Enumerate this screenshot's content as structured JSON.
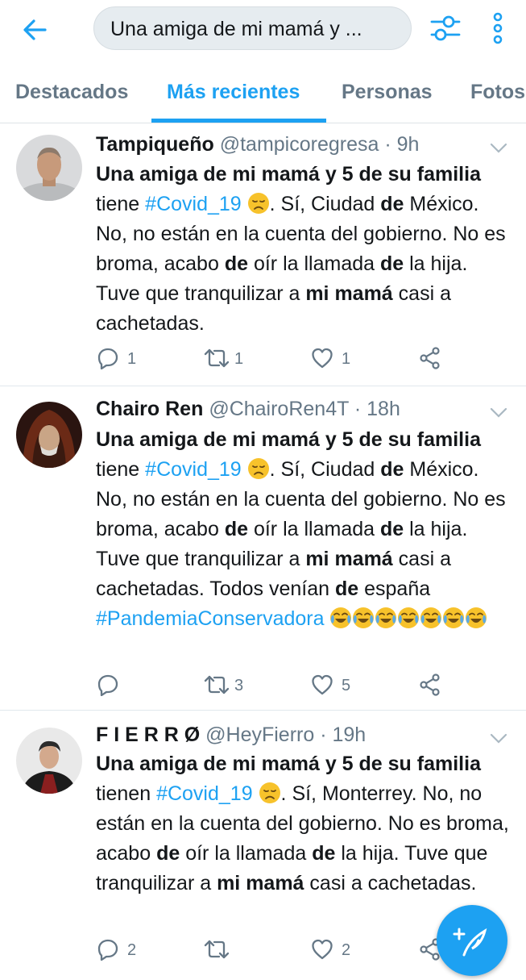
{
  "search": {
    "query": "Una amiga de mi mamá y ..."
  },
  "tabs": [
    {
      "label": "Destacados"
    },
    {
      "label": "Más recientes"
    },
    {
      "label": "Personas"
    },
    {
      "label": "Fotos"
    }
  ],
  "icons": {
    "back": "arrow-left-icon",
    "filter": "filter-sliders-icon",
    "more": "more-vertical-icon",
    "compose": "compose-feather-icon"
  },
  "colors": {
    "accent": "#1da1f2",
    "muted": "#657786"
  },
  "tweets": [
    {
      "name": "Tampiqueño",
      "handle": "@tampicoregresa",
      "sep": "·",
      "time": "9h",
      "segments": [
        {
          "t": "Una amiga de mi mamá y 5 de su familia",
          "s": "bold"
        },
        {
          "t": " tiene ",
          "s": "normal"
        },
        {
          "t": "#Covid_19",
          "s": "tag"
        },
        {
          "t": " ",
          "s": "normal"
        },
        {
          "t": "disappointed-face",
          "s": "emoji"
        },
        {
          "t": ". Sí, Ciudad ",
          "s": "normal"
        },
        {
          "t": "de",
          "s": "bold"
        },
        {
          "t": " México. No, no están en la cuenta del gobierno. No es broma, acabo ",
          "s": "normal"
        },
        {
          "t": "de",
          "s": "bold"
        },
        {
          "t": " oír la llamada ",
          "s": "normal"
        },
        {
          "t": "de",
          "s": "bold"
        },
        {
          "t": " la hija. Tuve que tranquilizar a ",
          "s": "normal"
        },
        {
          "t": "mi mamá",
          "s": "bold"
        },
        {
          "t": " casi a cachetadas.",
          "s": "normal"
        }
      ],
      "replies": "1",
      "retweets": "1",
      "likes": "1"
    },
    {
      "name": "Chairo Ren",
      "handle": "@ChairoRen4T",
      "sep": "·",
      "time": "18h",
      "segments": [
        {
          "t": "Una amiga de mi mamá y 5 de su familia",
          "s": "bold"
        },
        {
          "t": " tiene ",
          "s": "normal"
        },
        {
          "t": "#Covid_19",
          "s": "tag"
        },
        {
          "t": " ",
          "s": "normal"
        },
        {
          "t": "disappointed-face",
          "s": "emoji"
        },
        {
          "t": ". Sí, Ciudad ",
          "s": "normal"
        },
        {
          "t": "de",
          "s": "bold"
        },
        {
          "t": " México. No, no están en la cuenta del gobierno. No es broma, acabo ",
          "s": "normal"
        },
        {
          "t": "de",
          "s": "bold"
        },
        {
          "t": " oír la llamada ",
          "s": "normal"
        },
        {
          "t": "de",
          "s": "bold"
        },
        {
          "t": " la hija. Tuve que tranquilizar a ",
          "s": "normal"
        },
        {
          "t": "mi mamá",
          "s": "bold"
        },
        {
          "t": " casi a cachetadas. Todos venían ",
          "s": "normal"
        },
        {
          "t": "de",
          "s": "bold"
        },
        {
          "t": " españa ",
          "s": "normal"
        },
        {
          "t": "#PandemiaConservadora",
          "s": "tag"
        },
        {
          "t": " ",
          "s": "normal"
        },
        {
          "t": "crying-laughing-face",
          "s": "emoji"
        },
        {
          "t": "crying-laughing-face",
          "s": "emoji"
        },
        {
          "t": "crying-laughing-face",
          "s": "emoji"
        },
        {
          "t": "crying-laughing-face",
          "s": "emoji"
        },
        {
          "t": "crying-laughing-face",
          "s": "emoji"
        },
        {
          "t": "crying-laughing-face",
          "s": "emoji"
        },
        {
          "t": "crying-laughing-face",
          "s": "emoji"
        }
      ],
      "replies": "",
      "retweets": "3",
      "likes": "5"
    },
    {
      "name": "F I E R R Ø",
      "handle": "@HeyFierro",
      "sep": "·",
      "time": "19h",
      "segments": [
        {
          "t": "Una amiga de mi mamá y 5 de su familia",
          "s": "bold"
        },
        {
          "t": " tienen ",
          "s": "normal"
        },
        {
          "t": "#Covid_19",
          "s": "tag"
        },
        {
          "t": " ",
          "s": "normal"
        },
        {
          "t": "disappointed-face",
          "s": "emoji"
        },
        {
          "t": ". Sí, Monterrey. No, no están en la cuenta del gobierno. No es broma, acabo ",
          "s": "normal"
        },
        {
          "t": "de",
          "s": "bold"
        },
        {
          "t": " oír la llamada ",
          "s": "normal"
        },
        {
          "t": "de",
          "s": "bold"
        },
        {
          "t": " la hija. Tuve que tranquilizar a ",
          "s": "normal"
        },
        {
          "t": "mi mamá",
          "s": "bold"
        },
        {
          "t": " casi a cachetadas.",
          "s": "normal"
        }
      ],
      "replies": "2",
      "retweets": "",
      "likes": "2"
    }
  ]
}
